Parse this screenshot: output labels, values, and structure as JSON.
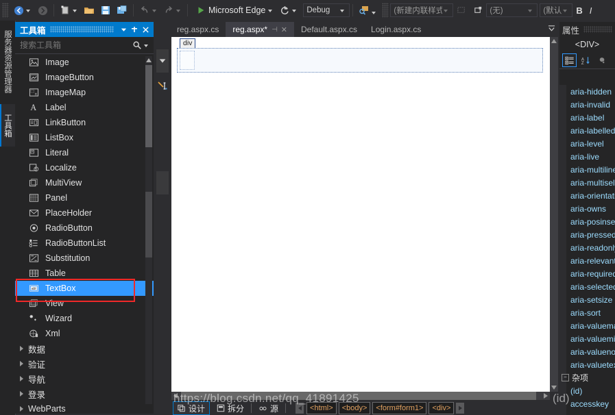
{
  "toolbar": {
    "nav_back": "back-arrow",
    "nav_forward": "forward-arrow",
    "new_item": "new-item",
    "open_file": "open-folder",
    "save": "save",
    "save_all": "save-all",
    "undo": "undo",
    "redo": "redo",
    "run_label": "Microsoft Edge",
    "refresh": "refresh",
    "config_value": "Debug",
    "find_icon": "find-in-files",
    "style_value": "(新建内联样式)",
    "target_value": "(无)",
    "size_value": "(默认大小)",
    "bold": "B",
    "italic": "I"
  },
  "vdock": {
    "server_explorer": "服务器资源管理器",
    "toolbox": "工具箱"
  },
  "toolbox": {
    "title": "工具箱",
    "search_placeholder": "搜索工具箱",
    "items": [
      {
        "label": "Image",
        "icon": "image-icon"
      },
      {
        "label": "ImageButton",
        "icon": "image-button-icon"
      },
      {
        "label": "ImageMap",
        "icon": "image-map-icon"
      },
      {
        "label": "Label",
        "icon": "label-icon"
      },
      {
        "label": "LinkButton",
        "icon": "link-button-icon"
      },
      {
        "label": "ListBox",
        "icon": "list-box-icon"
      },
      {
        "label": "Literal",
        "icon": "literal-icon"
      },
      {
        "label": "Localize",
        "icon": "localize-icon"
      },
      {
        "label": "MultiView",
        "icon": "multi-view-icon"
      },
      {
        "label": "Panel",
        "icon": "panel-icon"
      },
      {
        "label": "PlaceHolder",
        "icon": "place-holder-icon"
      },
      {
        "label": "RadioButton",
        "icon": "radio-button-icon"
      },
      {
        "label": "RadioButtonList",
        "icon": "radio-button-list-icon"
      },
      {
        "label": "Substitution",
        "icon": "substitution-icon"
      },
      {
        "label": "Table",
        "icon": "table-icon"
      },
      {
        "label": "TextBox",
        "icon": "text-box-icon"
      },
      {
        "label": "View",
        "icon": "view-icon"
      },
      {
        "label": "Wizard",
        "icon": "wizard-icon"
      },
      {
        "label": "Xml",
        "icon": "xml-icon"
      }
    ],
    "selected_item": "TextBox",
    "categories": [
      "数据",
      "验证",
      "导航",
      "登录",
      "WebParts"
    ]
  },
  "editor": {
    "tabs": [
      {
        "label": "reg.aspx.cs",
        "active": false
      },
      {
        "label": "reg.aspx*",
        "active": true
      },
      {
        "label": "Default.aspx.cs",
        "active": false
      },
      {
        "label": "Login.aspx.cs",
        "active": false
      }
    ],
    "design_tag": "div"
  },
  "viewbar": {
    "buttons": [
      {
        "label": "设计",
        "selected": true
      },
      {
        "label": "拆分",
        "selected": false
      },
      {
        "label": "源",
        "selected": false
      }
    ],
    "breadcrumbs": [
      "<html>",
      "<body>",
      "<form#form1>",
      "<div>"
    ]
  },
  "properties": {
    "title": "属性",
    "object": "<DIV>",
    "tool_categorized": "categorized-view-icon",
    "tool_alphabetical": "alphabetical-sort-icon",
    "tool_properties": "properties-wrench-icon",
    "items": [
      "aria-hidden",
      "aria-invalid",
      "aria-label",
      "aria-labelledby",
      "aria-level",
      "aria-live",
      "aria-multiline",
      "aria-multiselectable",
      "aria-orientation",
      "aria-owns",
      "aria-posinset",
      "aria-pressed",
      "aria-readonly",
      "aria-relevant",
      "aria-required",
      "aria-selected",
      "aria-setsize",
      "aria-sort",
      "aria-valuemax",
      "aria-valuemin",
      "aria-valuenow",
      "aria-valuetext"
    ],
    "group_label": "杂项",
    "group_items": [
      "(id)",
      "accesskey"
    ]
  },
  "watermark": {
    "text": "https://blog.csdn.net/qq_41891425",
    "overlay": "(id)"
  },
  "colors": {
    "accent": "#007acc",
    "selection": "#3399ff",
    "annotation": "#ef2929",
    "property_name": "#9cdcfe",
    "tag": "#e0a060"
  }
}
